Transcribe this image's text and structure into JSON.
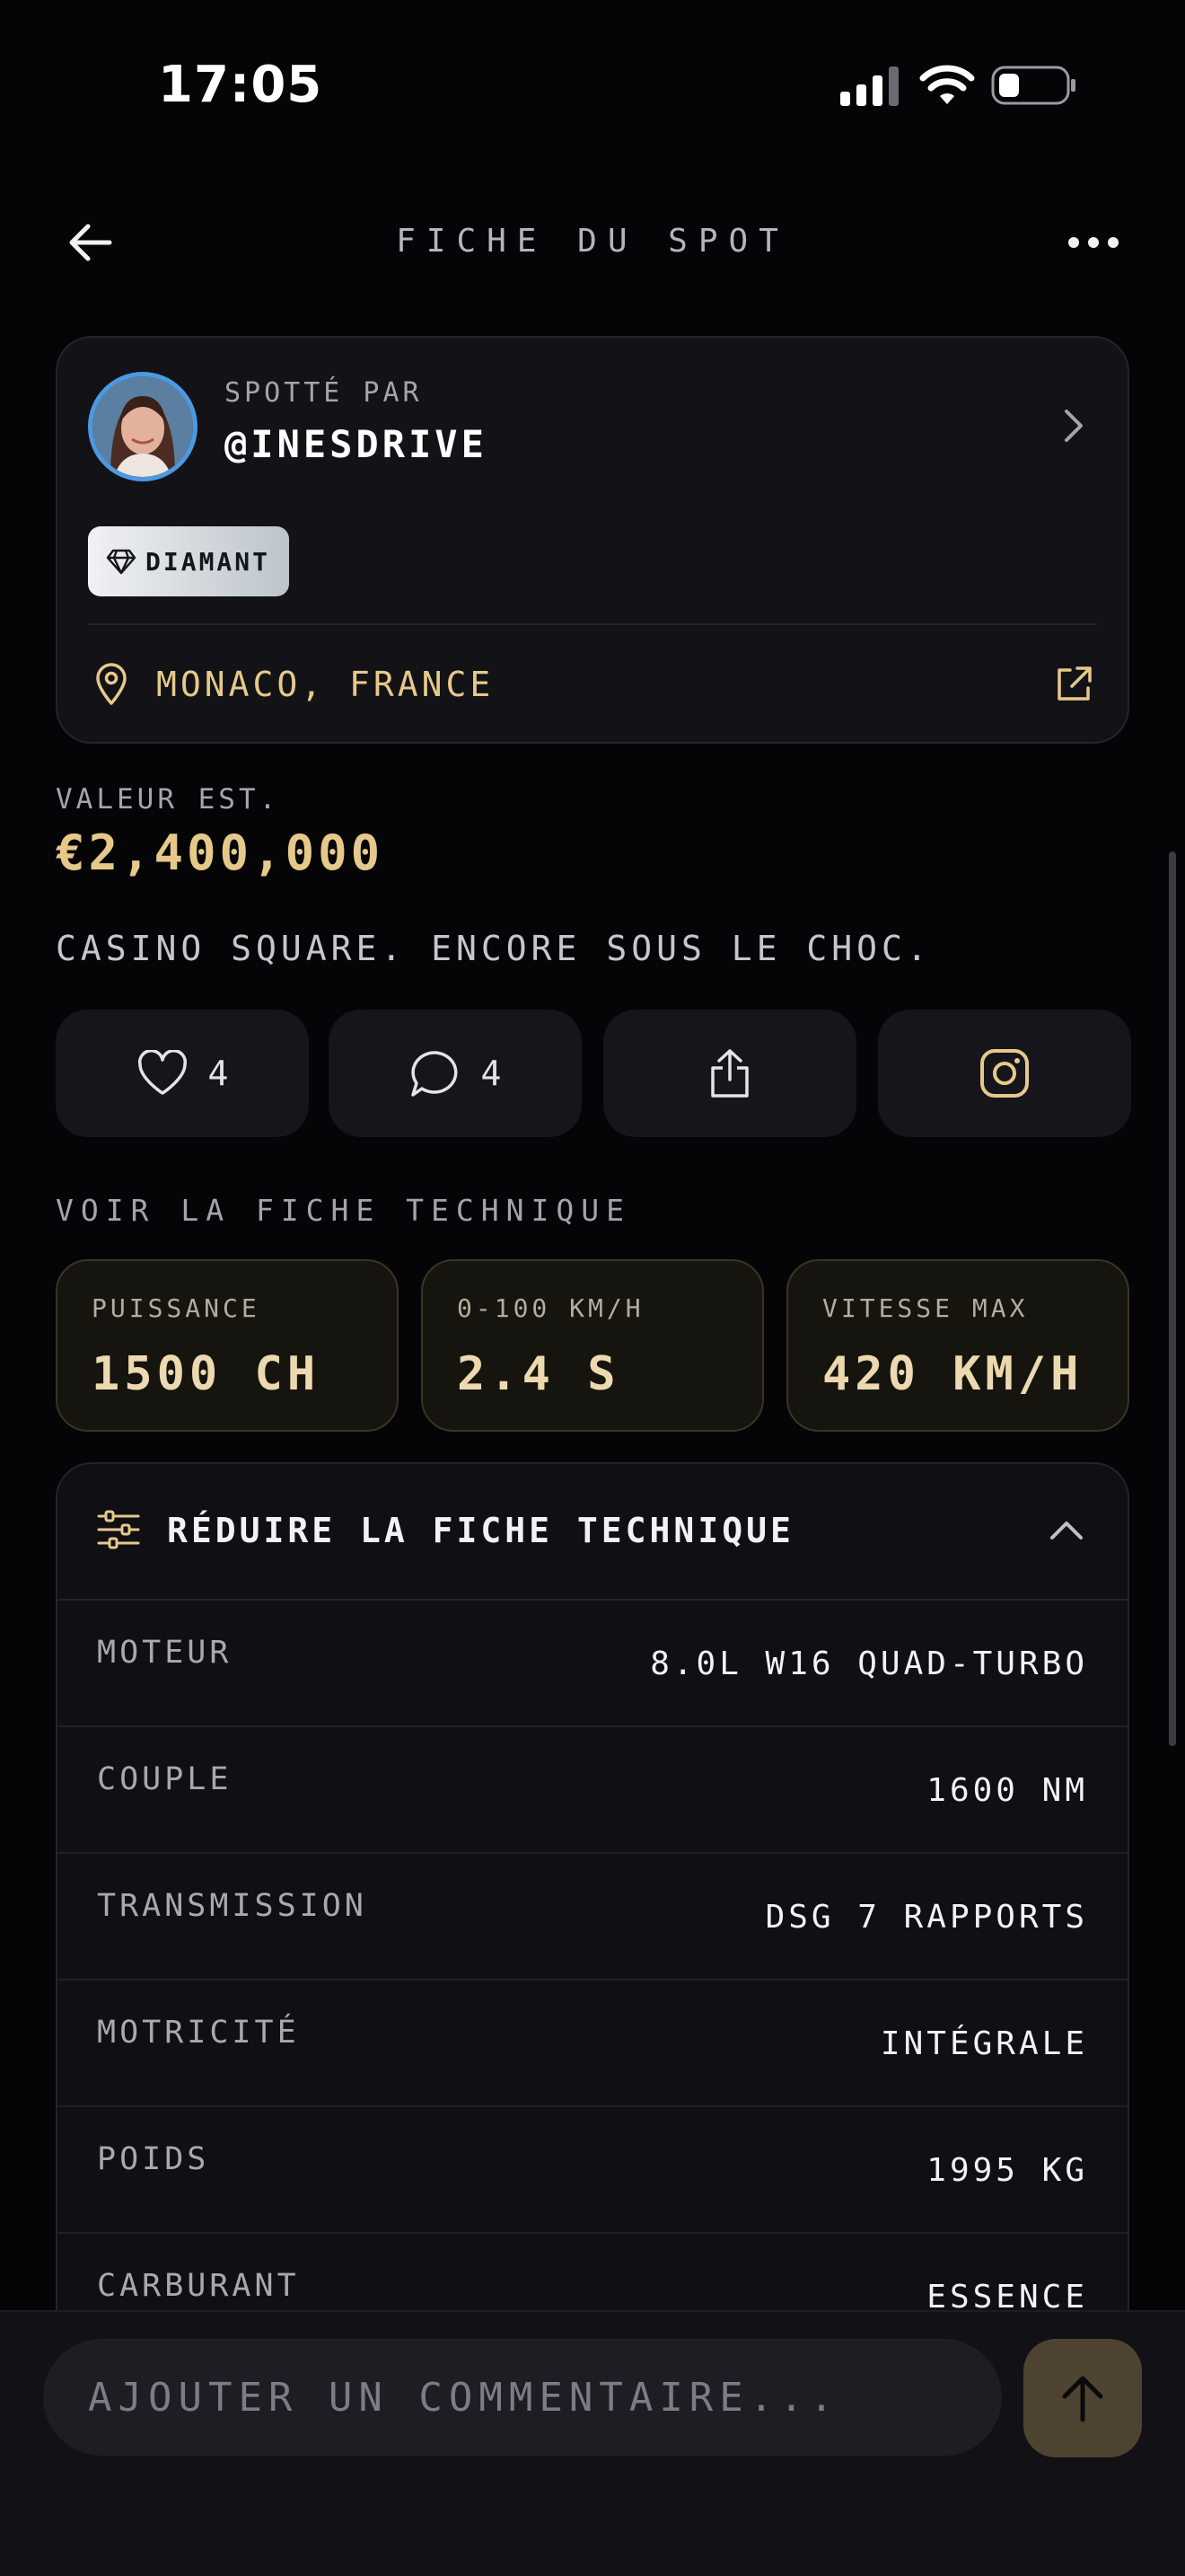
{
  "status_bar": {
    "time": "17:05"
  },
  "header": {
    "title": "FICHE DU SPOT"
  },
  "spotter": {
    "label": "SPOTTÉ PAR",
    "username": "@INESDRIVE",
    "badge": "DIAMANT",
    "location": "MONACO, FRANCE"
  },
  "value": {
    "label": "VALEUR EST.",
    "amount": "€2,400,000"
  },
  "caption": "CASINO SQUARE. ENCORE SOUS LE CHOC.",
  "actions": {
    "likes": "4",
    "comments": "4"
  },
  "voir_label": "VOIR LA FICHE TECHNIQUE",
  "stats": [
    {
      "label": "PUISSANCE",
      "value": "1500 CH"
    },
    {
      "label": "0-100 KM/H",
      "value": "2.4 S"
    },
    {
      "label": "VITESSE MAX",
      "value": "420 KM/H"
    }
  ],
  "specs": {
    "title": "RÉDUIRE LA FICHE TECHNIQUE",
    "rows": [
      {
        "key": "MOTEUR",
        "value": "8.0L W16 QUAD-TURBO"
      },
      {
        "key": "COUPLE",
        "value": "1600 NM"
      },
      {
        "key": "TRANSMISSION",
        "value": "DSG 7 RAPPORTS"
      },
      {
        "key": "MOTRICITÉ",
        "value": "INTÉGRALE"
      },
      {
        "key": "POIDS",
        "value": "1995 KG"
      },
      {
        "key": "CARBURANT",
        "value": "ESSENCE"
      }
    ]
  },
  "comment": {
    "placeholder": "AJOUTER UN COMMENTAIRE..."
  },
  "colors": {
    "accent": "#e6c98a",
    "background": "#050507",
    "card": "#121217"
  }
}
